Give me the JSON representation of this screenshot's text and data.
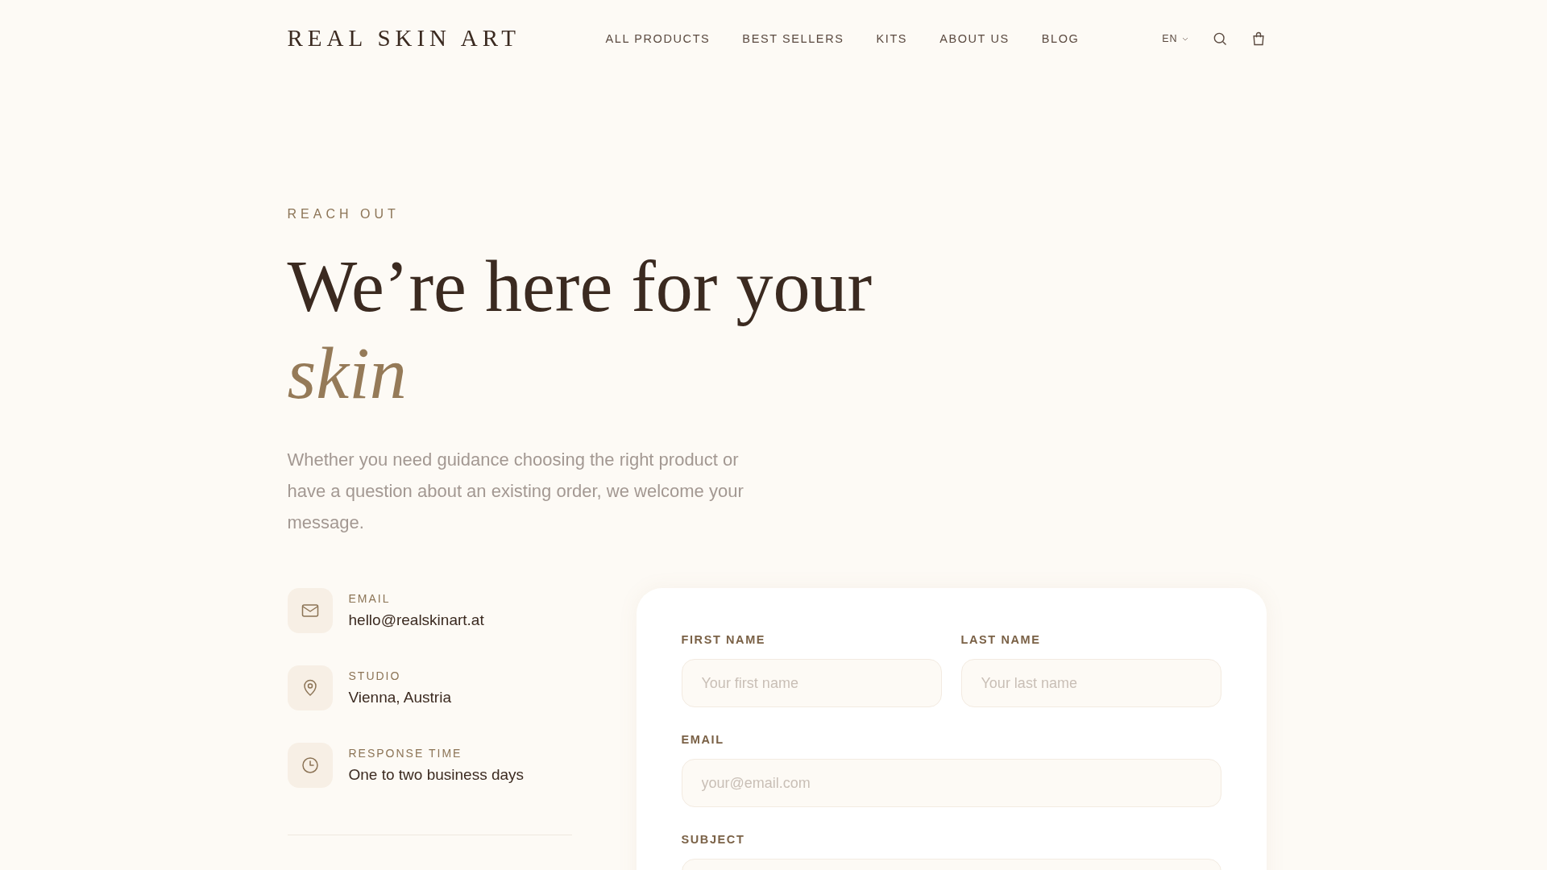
{
  "header": {
    "logo": "REAL SKIN ART",
    "nav": [
      {
        "label": "ALL PRODUCTS"
      },
      {
        "label": "BEST SELLERS"
      },
      {
        "label": "KITS"
      },
      {
        "label": "ABOUT US"
      },
      {
        "label": "BLOG"
      }
    ],
    "language": "EN"
  },
  "hero": {
    "eyebrow": "REACH OUT",
    "title": "We’re here for your",
    "title_accent": "skin",
    "intro": "Whether you need guidance choosing the right product or have a question about an existing order, we welcome your message."
  },
  "contacts": [
    {
      "kind": "email",
      "label": "EMAIL",
      "value": "hello@realskinart.at"
    },
    {
      "kind": "location",
      "label": "STUDIO",
      "value": "Vienna, Austria"
    },
    {
      "kind": "time",
      "label": "RESPONSE TIME",
      "value": "One to two business days"
    }
  ],
  "form": {
    "rows": [
      [
        {
          "label": "FIRST NAME",
          "placeholder": "Your first name"
        },
        {
          "label": "LAST NAME",
          "placeholder": "Your last name"
        }
      ],
      [
        {
          "label": "EMAIL",
          "placeholder": "your@email.com"
        }
      ],
      [
        {
          "label": "SUBJECT"
        }
      ]
    ]
  }
}
